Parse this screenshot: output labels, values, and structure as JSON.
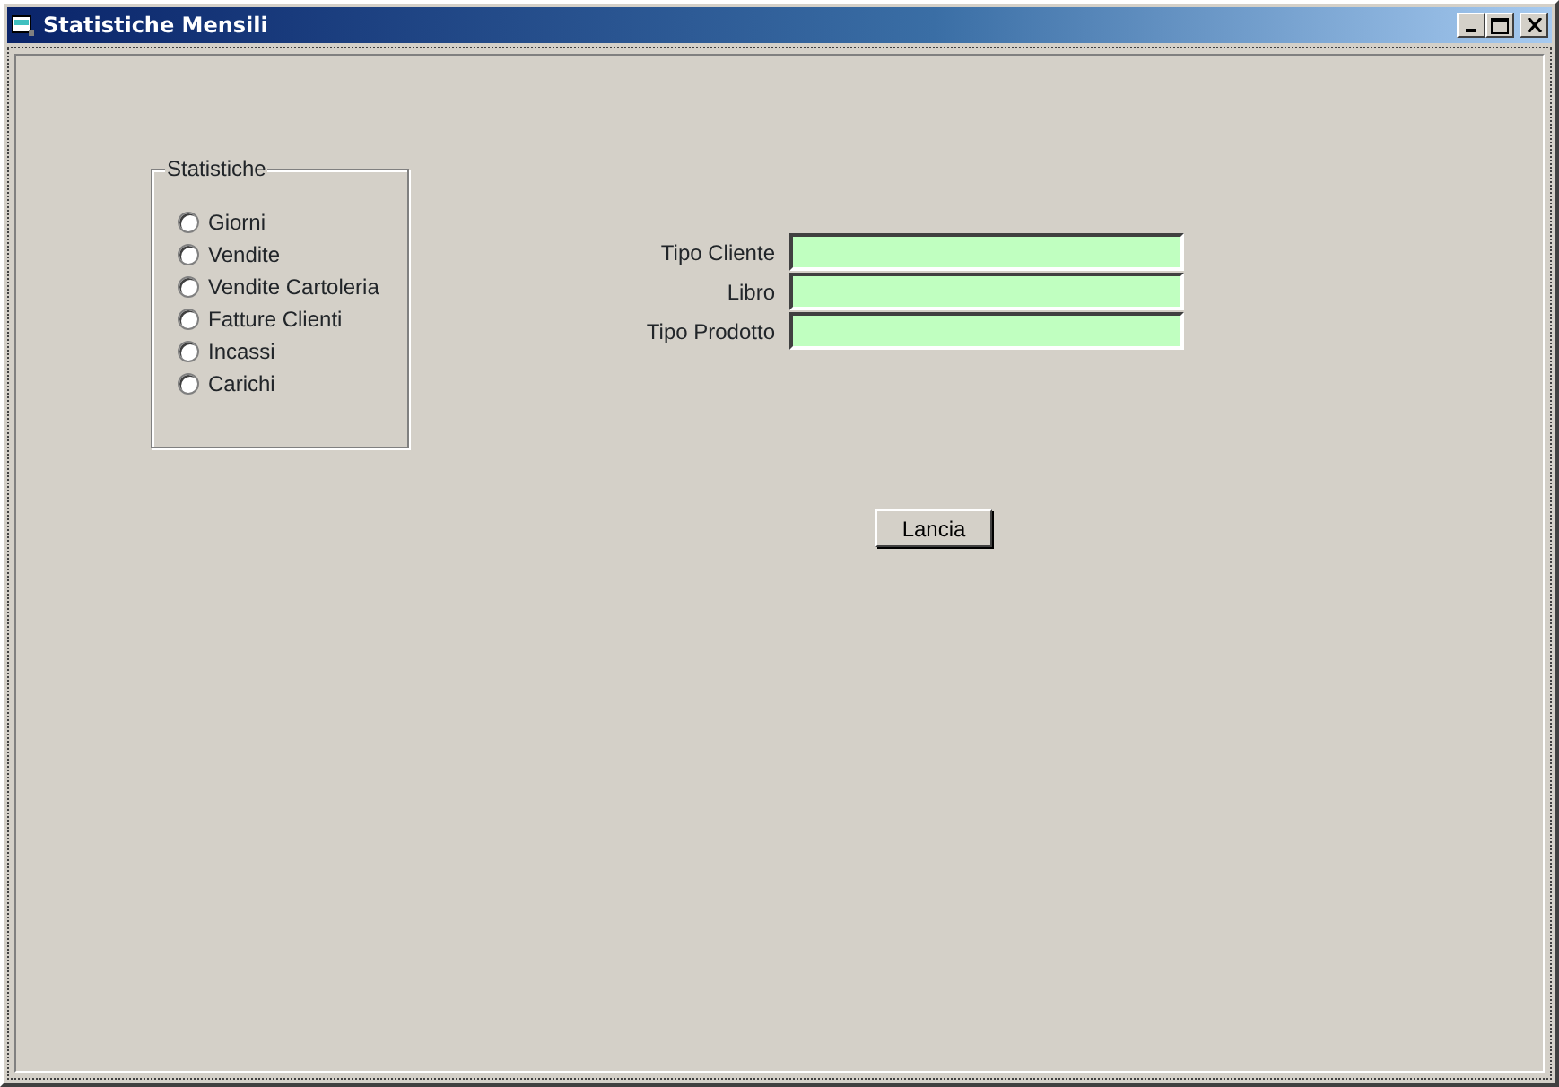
{
  "window": {
    "title": "Statistiche Mensili"
  },
  "group": {
    "title": "Statistiche",
    "options": [
      {
        "label": "Giorni",
        "selected": false
      },
      {
        "label": "Vendite",
        "selected": false
      },
      {
        "label": "Vendite Cartoleria",
        "selected": false
      },
      {
        "label": "Fatture Clienti",
        "selected": false
      },
      {
        "label": "Incassi",
        "selected": false
      },
      {
        "label": "Carichi",
        "selected": false
      }
    ]
  },
  "fields": [
    {
      "label": "Tipo Cliente"
    },
    {
      "label": "Libro"
    },
    {
      "label": "Tipo Prodotto"
    }
  ],
  "button": "Lancia"
}
